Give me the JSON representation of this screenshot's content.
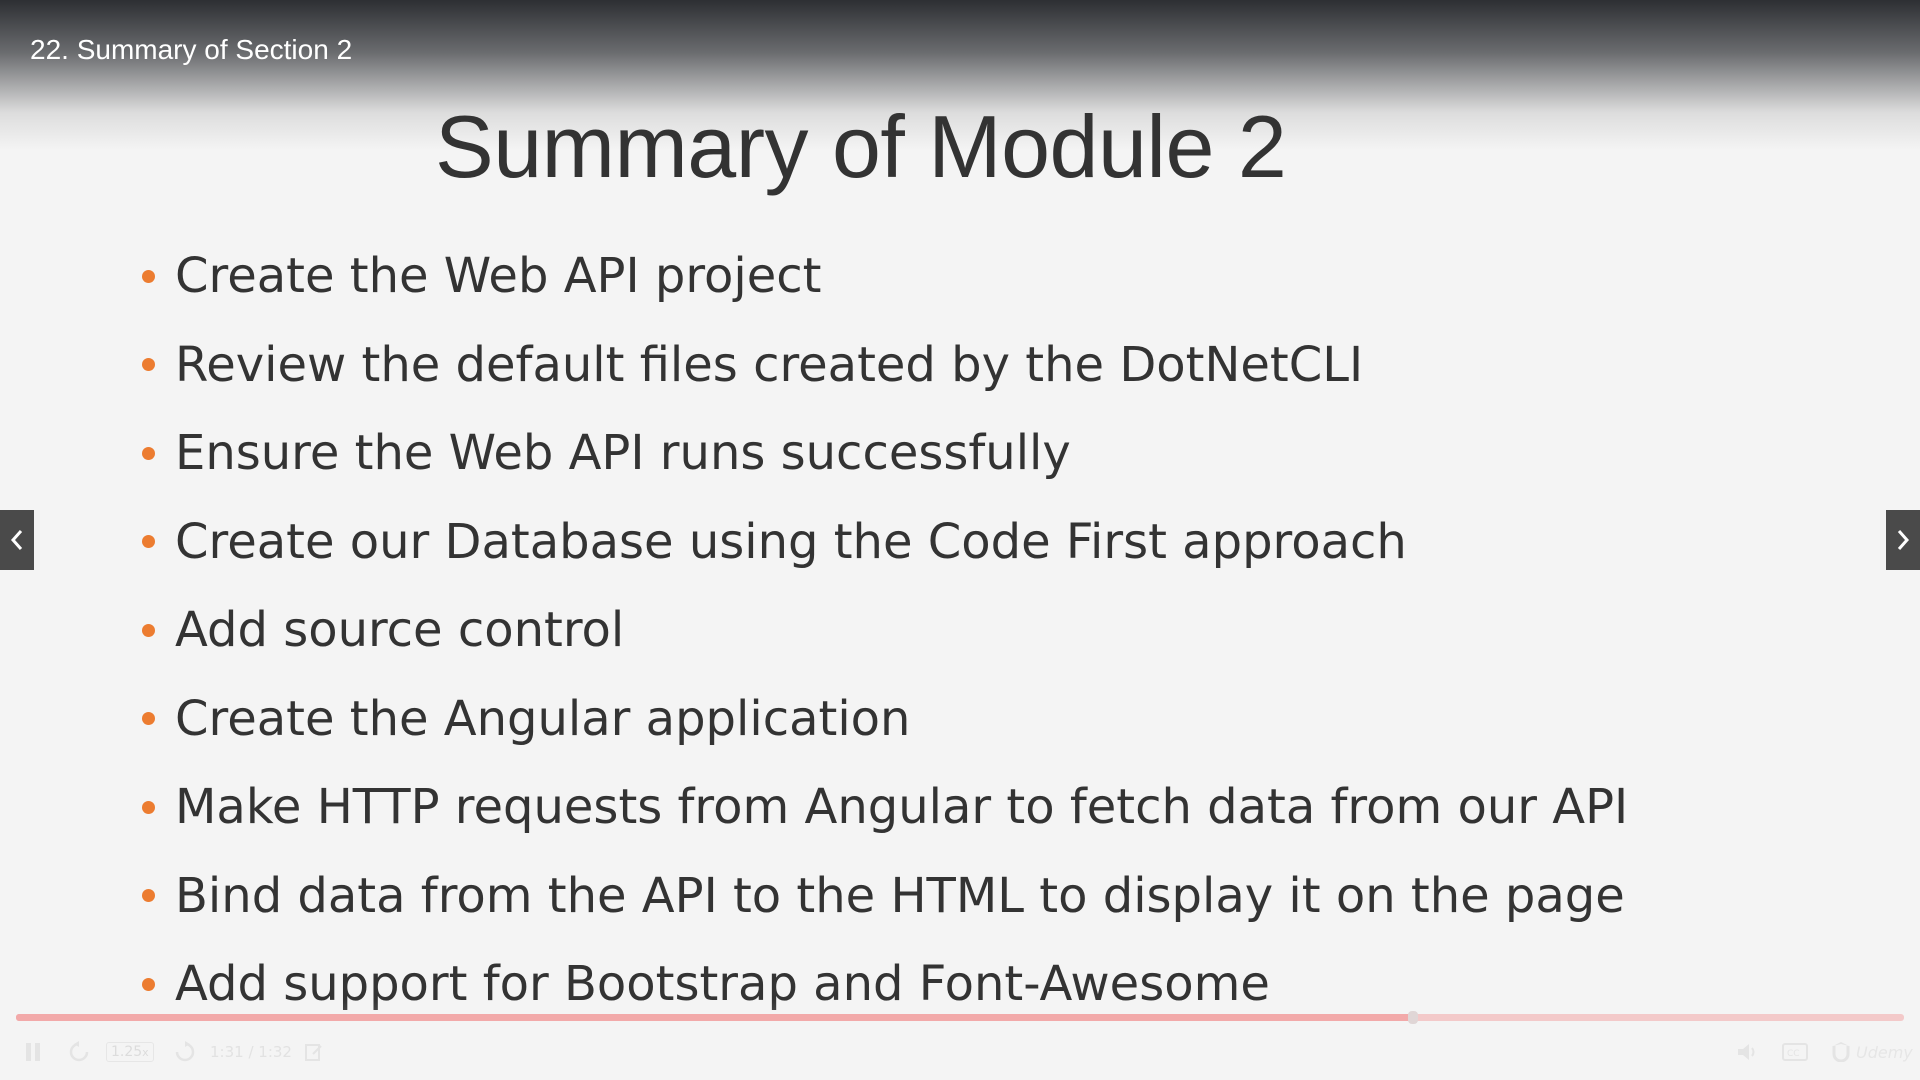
{
  "lecture": {
    "title": "22. Summary of Section 2"
  },
  "slide": {
    "title": "Summary of Module 2",
    "bullet_color": "#ec7c30",
    "bullets": [
      "Create the Web API project",
      "Review the default files created by the DotNetCLI",
      "Ensure the Web API runs successfully",
      "Create our Database using the Code First approach",
      "Add source control",
      "Create the Angular application",
      "Make HTTP requests from Angular to fetch data from our API",
      "Bind data from the API to the HTML to display it on the page",
      "Add support for Bootstrap and Font-Awesome"
    ]
  },
  "player": {
    "speed": "1.25",
    "speed_suffix": "x",
    "time": "1:31 / 1:32",
    "progress_fraction": 0.74,
    "brand": "Udemy",
    "icons": [
      "pause-icon",
      "rewind-icon",
      "forward-icon",
      "notes-icon",
      "volume-icon",
      "captions-icon",
      "brand-logo-icon"
    ]
  }
}
